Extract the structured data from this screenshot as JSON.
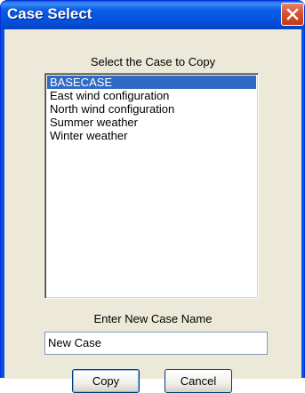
{
  "window": {
    "title": "Case Select"
  },
  "case_list": {
    "label": "Select the Case to Copy",
    "items": [
      "BASECASE",
      "East wind configuration",
      "North wind configuration",
      "Summer weather",
      "Winter weather"
    ],
    "selected_index": 0
  },
  "new_case": {
    "label": "Enter New Case Name",
    "value": "New Case"
  },
  "buttons": {
    "copy": "Copy",
    "cancel": "Cancel"
  },
  "colors": {
    "title_bar": "#0054e3",
    "selection": "#316ac5",
    "dialog_face": "#ece9d8",
    "close_button": "#d8512e"
  },
  "icons": {
    "close": "close-icon"
  }
}
